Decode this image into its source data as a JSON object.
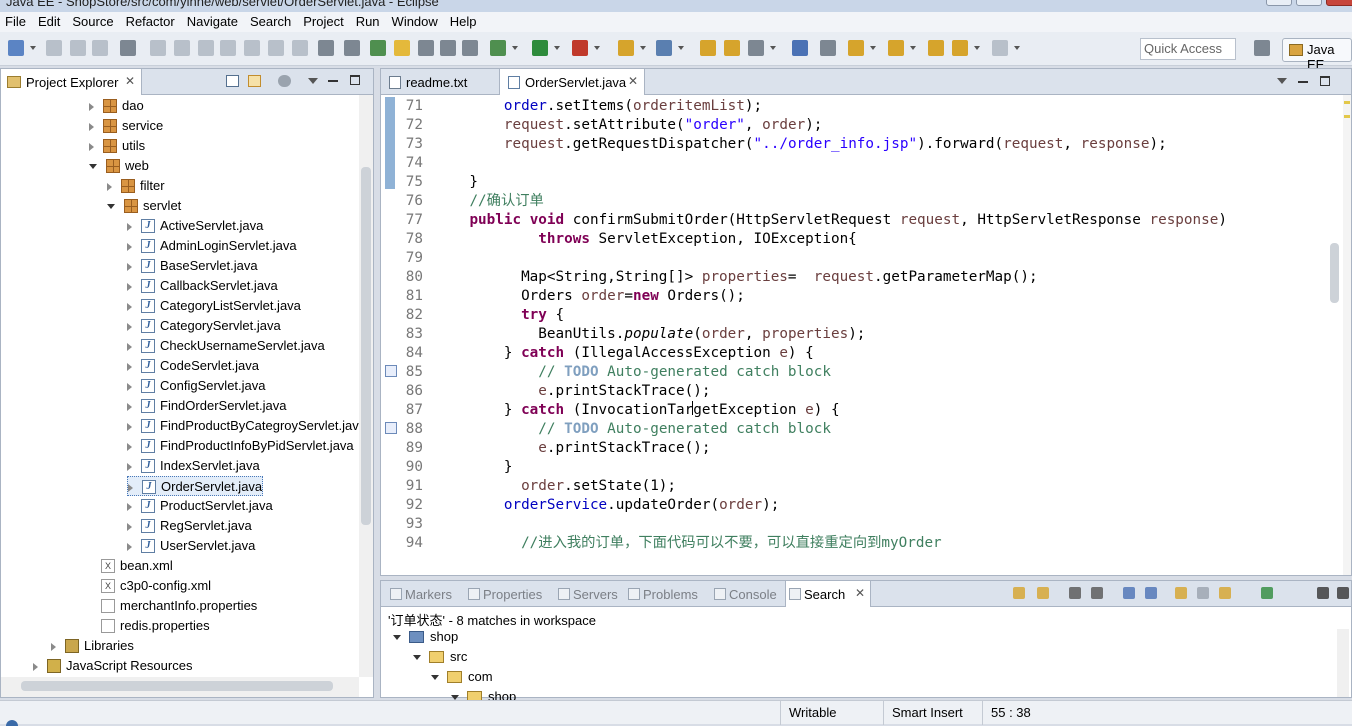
{
  "window": {
    "title": "Java EE - ShopStore/src/com/yinne/web/servlet/OrderServlet.java - Eclipse"
  },
  "menu": [
    "File",
    "Edit",
    "Source",
    "Refactor",
    "Navigate",
    "Search",
    "Project",
    "Run",
    "Window",
    "Help"
  ],
  "toolbar": {
    "quick_access_placeholder": "Quick Access",
    "perspective": "Java EE"
  },
  "project_explorer": {
    "tab_label": "Project Explorer",
    "close_glyph": "✕",
    "items": [
      {
        "label": "dao",
        "indent": 0,
        "type": "pkg",
        "twisty": "closed"
      },
      {
        "label": "service",
        "indent": 0,
        "type": "pkg",
        "twisty": "closed"
      },
      {
        "label": "utils",
        "indent": 0,
        "type": "pkg",
        "twisty": "closed"
      },
      {
        "label": "web",
        "indent": 0,
        "type": "pkg",
        "twisty": "open"
      },
      {
        "label": "filter",
        "indent": 1,
        "type": "pkg",
        "twisty": "closed"
      },
      {
        "label": "servlet",
        "indent": 1,
        "type": "pkg",
        "twisty": "open"
      },
      {
        "label": "ActiveServlet.java",
        "indent": 2,
        "type": "java",
        "twisty": "closed"
      },
      {
        "label": "AdminLoginServlet.java",
        "indent": 2,
        "type": "java",
        "twisty": "closed"
      },
      {
        "label": "BaseServlet.java",
        "indent": 2,
        "type": "java",
        "twisty": "closed"
      },
      {
        "label": "CallbackServlet.java",
        "indent": 2,
        "type": "java",
        "twisty": "closed"
      },
      {
        "label": "CategoryListServlet.java",
        "indent": 2,
        "type": "java",
        "twisty": "closed"
      },
      {
        "label": "CategoryServlet.java",
        "indent": 2,
        "type": "java",
        "twisty": "closed"
      },
      {
        "label": "CheckUsernameServlet.java",
        "indent": 2,
        "type": "java",
        "twisty": "closed"
      },
      {
        "label": "CodeServlet.java",
        "indent": 2,
        "type": "java",
        "twisty": "closed"
      },
      {
        "label": "ConfigServlet.java",
        "indent": 2,
        "type": "java",
        "twisty": "closed"
      },
      {
        "label": "FindOrderServlet.java",
        "indent": 2,
        "type": "java",
        "twisty": "closed"
      },
      {
        "label": "FindProductByCategroyServlet.java",
        "indent": 2,
        "type": "java",
        "twisty": "closed"
      },
      {
        "label": "FindProductInfoByPidServlet.java",
        "indent": 2,
        "type": "java",
        "twisty": "closed"
      },
      {
        "label": "IndexServlet.java",
        "indent": 2,
        "type": "java",
        "twisty": "closed"
      },
      {
        "label": "OrderServlet.java",
        "indent": 2,
        "type": "java",
        "twisty": "closed",
        "selected": true
      },
      {
        "label": "ProductServlet.java",
        "indent": 2,
        "type": "java",
        "twisty": "closed"
      },
      {
        "label": "RegServlet.java",
        "indent": 2,
        "type": "java",
        "twisty": "closed"
      },
      {
        "label": "UserServlet.java",
        "indent": 2,
        "type": "java",
        "twisty": "closed"
      },
      {
        "label": "bean.xml",
        "indent": -1,
        "type": "xml",
        "twisty": "none"
      },
      {
        "label": "c3p0-config.xml",
        "indent": -1,
        "type": "xml",
        "twisty": "none"
      },
      {
        "label": "merchantInfo.properties",
        "indent": -1,
        "type": "prop",
        "twisty": "none"
      },
      {
        "label": "redis.properties",
        "indent": -1,
        "type": "prop",
        "twisty": "none"
      },
      {
        "label": "Libraries",
        "indent": -2,
        "type": "lib",
        "twisty": "closed"
      },
      {
        "label": "JavaScript Resources",
        "indent": -3,
        "type": "js",
        "twisty": "closed"
      }
    ]
  },
  "editor": {
    "tabs": [
      {
        "label": "readme.txt",
        "active": false
      },
      {
        "label": "OrderServlet.java",
        "active": true
      }
    ],
    "lines": [
      {
        "n": "71",
        "html": "        <span class=\"fd\">order</span>.setItems(<span class=\"pv\">orderitemList</span>);"
      },
      {
        "n": "72",
        "html": "        <span class=\"pv\">request</span>.setAttribute(<span class=\"st\">\"order\"</span>, <span class=\"pv\">order</span>);"
      },
      {
        "n": "73",
        "html": "        <span class=\"pv\">request</span>.getRequestDispatcher(<span class=\"st\">\"../order_info.jsp\"</span>).forward(<span class=\"pv\">request</span>, <span class=\"pv\">response</span>);"
      },
      {
        "n": "74",
        "html": ""
      },
      {
        "n": "75",
        "html": "    }"
      },
      {
        "n": "76",
        "html": "    <span class=\"cm\">//确认订单</span>"
      },
      {
        "n": "77",
        "html": "    <span class=\"kw\">public</span> <span class=\"kw\">void</span> confirmSubmitOrder(HttpServletRequest <span class=\"pv\">request</span>, HttpServletResponse <span class=\"pv\">response</span>)"
      },
      {
        "n": "78",
        "html": "            <span class=\"kw\">throws</span> ServletException, IOException{"
      },
      {
        "n": "79",
        "html": ""
      },
      {
        "n": "80",
        "html": "          Map&lt;String,String[]&gt; <span class=\"pv\">properties</span>=  <span class=\"pv\">request</span>.getParameterMap();"
      },
      {
        "n": "81",
        "html": "          Orders <span class=\"pv\">order</span>=<span class=\"kw\">new</span> Orders();"
      },
      {
        "n": "82",
        "html": "          <span class=\"kw\">try</span> {"
      },
      {
        "n": "83",
        "html": "            BeanUtils.<span class=\"it\">populate</span>(<span class=\"pv\">order</span>, <span class=\"pv\">properties</span>);"
      },
      {
        "n": "84",
        "html": "        } <span class=\"kw\">catch</span> (IllegalAccessException <span class=\"pv\">e</span>) {"
      },
      {
        "n": "85",
        "html": "            <span class=\"cm\">// <span class=\"td\">TODO</span> Auto-generated catch block</span>"
      },
      {
        "n": "86",
        "html": "            <span class=\"pv\">e</span>.printStackTrace();"
      },
      {
        "n": "87",
        "html": "        } <span class=\"kw\">catch</span> (InvocationTargetException <span class=\"pv\">e</span>) {"
      },
      {
        "n": "88",
        "html": "            <span class=\"cm\">// <span class=\"td\">TODO</span> Auto-generated catch block</span>"
      },
      {
        "n": "89",
        "html": "            <span class=\"pv\">e</span>.printStackTrace();"
      },
      {
        "n": "90",
        "html": "        }"
      },
      {
        "n": "91",
        "html": "          <span class=\"pv\">order</span>.setState(1);"
      },
      {
        "n": "92",
        "html": "        <span class=\"fd\">orderService</span>.updateOrder(<span class=\"pv\">order</span>);"
      },
      {
        "n": "93",
        "html": ""
      },
      {
        "n": "94",
        "html": "          <span class=\"cm\">//进入我的订单，下面代码可以不要，可以直接重定向到myOrder</span>"
      }
    ]
  },
  "bottom_panel": {
    "tabs": [
      {
        "label": "Markers",
        "active": false
      },
      {
        "label": "Properties",
        "active": false
      },
      {
        "label": "Servers",
        "active": false
      },
      {
        "label": "Problems",
        "active": false
      },
      {
        "label": "Console",
        "active": false
      },
      {
        "label": "Search",
        "active": true
      }
    ],
    "search_summary": "'订单状态' - 8 matches in workspace",
    "results": [
      {
        "label": "shop",
        "type": "proj",
        "twisty": "open",
        "indent": 0
      },
      {
        "label": "src",
        "type": "folder",
        "twisty": "open",
        "indent": 1
      },
      {
        "label": "com",
        "type": "folder",
        "twisty": "open",
        "indent": 2
      },
      {
        "label": "shop",
        "type": "folder",
        "twisty": "open",
        "indent": 3
      }
    ]
  },
  "status_bar": {
    "writable": "Writable",
    "insert_mode": "Smart Insert",
    "cursor": "55 : 38"
  },
  "colors": {
    "keyword": "#7f0055",
    "string": "#2a00ff",
    "comment": "#3f7f5f",
    "field": "#0000c0",
    "param": "#6a3e3e",
    "selection": "#e3edf9"
  }
}
